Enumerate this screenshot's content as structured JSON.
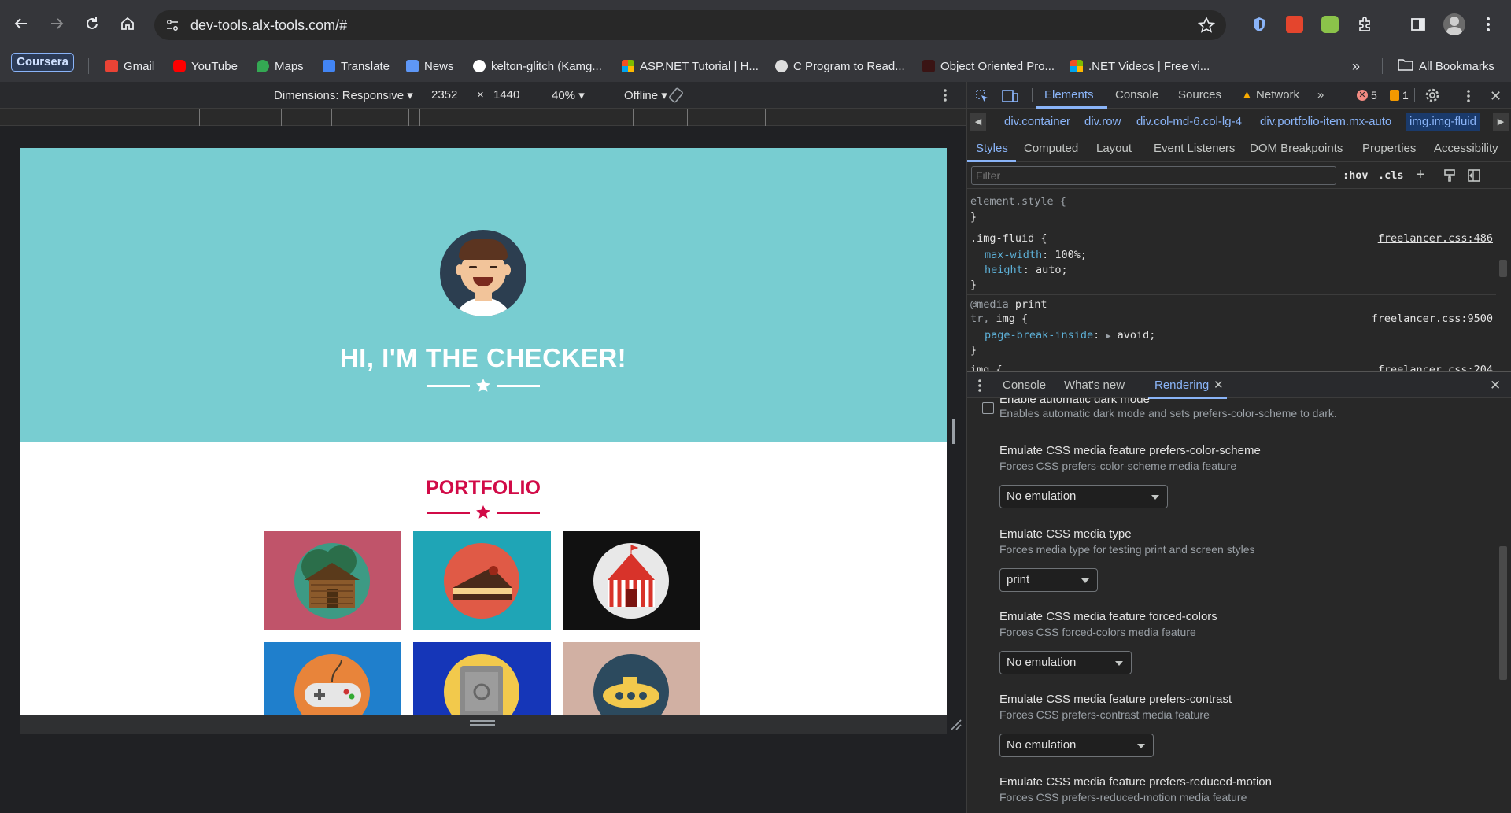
{
  "browser": {
    "url": "dev-tools.alx-tools.com/#",
    "bookmarks": [
      {
        "label": "Coursera",
        "color": "#3b6fd4"
      },
      {
        "label": "Gmail",
        "color": "#ea4335"
      },
      {
        "label": "YouTube",
        "color": "#ff0000"
      },
      {
        "label": "Maps",
        "color": "#34a853"
      },
      {
        "label": "Translate",
        "color": "#4285f4"
      },
      {
        "label": "News",
        "color": "#5e97f6"
      },
      {
        "label": "kelton-glitch (Kamg...",
        "color": "#ffffff"
      },
      {
        "label": "ASP.NET Tutorial | H...",
        "color": "#f25022"
      },
      {
        "label": "C Program to Read...",
        "color": "#dddddd"
      },
      {
        "label": "Object Oriented Pro...",
        "color": "#3a1414"
      },
      {
        "label": ".NET Videos | Free vi...",
        "color": "#f25022"
      }
    ],
    "all_bookmarks": "All Bookmarks",
    "more_chevron": "»"
  },
  "device_toolbar": {
    "dimensions": "Dimensions: Responsive",
    "width": "2352",
    "times": "×",
    "height": "1440",
    "zoom": "40%",
    "throttle": "Offline"
  },
  "page": {
    "hero_title": "HI, I'M THE CHECKER!",
    "portfolio_title": "PORTFOLIO",
    "hero_bg": "#78cdd1",
    "accent": "#d10a47"
  },
  "devtools": {
    "tabs": [
      "Elements",
      "Console",
      "Sources",
      "Network"
    ],
    "active_tab": "Elements",
    "error_count": "5",
    "warning_count": "1",
    "breadcrumbs": [
      "div.container",
      "div.row",
      "div.col-md-6.col-lg-4",
      "div.portfolio-item.mx-auto",
      "img.img-fluid"
    ],
    "subtabs": [
      "Styles",
      "Computed",
      "Layout",
      "Event Listeners",
      "DOM Breakpoints",
      "Properties",
      "Accessibility"
    ],
    "filter_placeholder": "Filter",
    "hov": ":hov",
    "cls": ".cls",
    "styles": {
      "element_style": "element.style {",
      "close": "}",
      "rule1_selector": ".img-fluid {",
      "rule1_source": "freelancer.css:486",
      "rule1_props": [
        {
          "name": "max-width",
          "value": "100%;"
        },
        {
          "name": "height",
          "value": "auto;"
        }
      ],
      "media_label": "@media",
      "media_value": "print",
      "rule2_selector_muted": "tr,",
      "rule2_selector": "img {",
      "rule2_source": "freelancer.css:9500",
      "rule2_prop": {
        "name": "page-break-inside",
        "value": "avoid;"
      },
      "rule3_selector": "img {",
      "rule3_source": "freelancer.css:204"
    },
    "drawer_tabs": [
      "Console",
      "What's new",
      "Rendering"
    ],
    "active_drawer": "Rendering",
    "rendering": {
      "dark_mode_title": "Enable automatic dark mode",
      "dark_mode_desc": "Enables automatic dark mode and sets prefers-color-scheme to dark.",
      "items": [
        {
          "title": "Emulate CSS media feature prefers-color-scheme",
          "desc": "Forces CSS prefers-color-scheme media feature",
          "value": "No emulation"
        },
        {
          "title": "Emulate CSS media type",
          "desc": "Forces media type for testing print and screen styles",
          "value": "print"
        },
        {
          "title": "Emulate CSS media feature forced-colors",
          "desc": "Forces CSS forced-colors media feature",
          "value": "No emulation"
        },
        {
          "title": "Emulate CSS media feature prefers-contrast",
          "desc": "Forces CSS prefers-contrast media feature",
          "value": "No emulation"
        },
        {
          "title": "Emulate CSS media feature prefers-reduced-motion",
          "desc": "Forces CSS prefers-reduced-motion media feature",
          "value": ""
        }
      ]
    }
  }
}
